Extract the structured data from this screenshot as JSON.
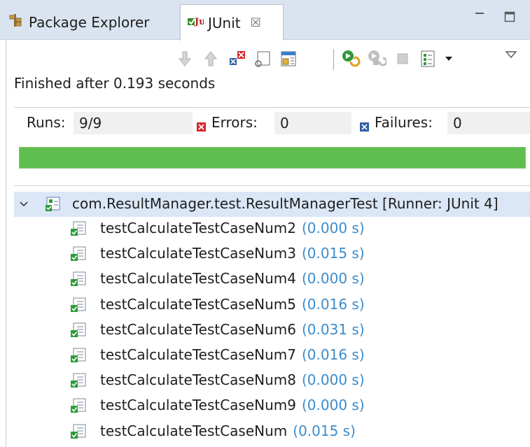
{
  "tabs": {
    "package_explorer": "Package Explorer",
    "junit": "JUnit",
    "close_glyph": "☒"
  },
  "toolbar": {
    "icons": [
      "next-failure-icon",
      "previous-failure-icon",
      "show-failures-only-icon",
      "scroll-lock-icon",
      "show-skipped-icon",
      "rerun-icon",
      "rerun-failed-icon",
      "stop-icon",
      "history-icon",
      "dropdown-arrow-icon",
      "view-menu-icon"
    ]
  },
  "status": {
    "text": "Finished after 0.193 seconds"
  },
  "counters": {
    "runs_label": "Runs:",
    "runs_value": "9/9",
    "errors_label": "Errors:",
    "errors_value": "0",
    "failures_label": "Failures:",
    "failures_value": "0"
  },
  "progress": {
    "fraction": 1.0,
    "color": "#5fbf4e"
  },
  "tree": {
    "suite": "com.ResultManager.test.ResultManagerTest [Runner: JUnit 4]",
    "cases": [
      {
        "name": "testCalculateTestCaseNum2",
        "time": "(0.000 s)"
      },
      {
        "name": "testCalculateTestCaseNum3",
        "time": "(0.015 s)"
      },
      {
        "name": "testCalculateTestCaseNum4",
        "time": "(0.000 s)"
      },
      {
        "name": "testCalculateTestCaseNum5",
        "time": "(0.016 s)"
      },
      {
        "name": "testCalculateTestCaseNum6",
        "time": "(0.031 s)"
      },
      {
        "name": "testCalculateTestCaseNum7",
        "time": "(0.016 s)"
      },
      {
        "name": "testCalculateTestCaseNum8",
        "time": "(0.000 s)"
      },
      {
        "name": "testCalculateTestCaseNum9",
        "time": "(0.000 s)"
      },
      {
        "name": "testCalculateTestCaseNum",
        "time": "(0.015 s)"
      }
    ]
  },
  "colors": {
    "tab_bar": "#dae4f0",
    "selection": "#dbe7f7",
    "time_text": "#3c8ccc",
    "error_red": "#d8262b",
    "failure_blue": "#2f5fa8"
  }
}
